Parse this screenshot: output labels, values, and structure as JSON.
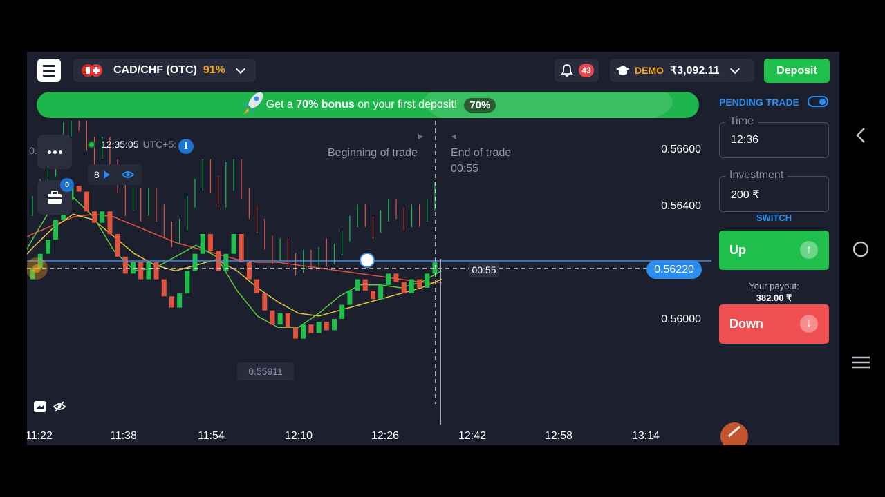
{
  "header": {
    "asset_name": "CAD/CHF (OTC)",
    "asset_payout_pct": "91%",
    "notifications_count": "43",
    "account_type": "DEMO",
    "balance": "₹3,092.11",
    "deposit_label": "Deposit"
  },
  "banner": {
    "text_prefix": "Get a",
    "text_bold": "70% bonus",
    "text_suffix": "on your first deposit!",
    "tag": "70%"
  },
  "chart": {
    "clock": "12:35:05",
    "timezone": "UTC+5:",
    "indicator_count": "8",
    "portfolio_count": "0",
    "cut_price_label": "0.",
    "beginning_label": "Beginning of trade",
    "end_label": "End of trade",
    "end_timer": "00:55",
    "line_timer": "00:55",
    "current_price": "0.56220",
    "low_label": "0.55911",
    "current_time_marker": "12:36"
  },
  "right_panel": {
    "pending_trade_label": "PENDING TRADE",
    "pending_trade_enabled": true,
    "time_label": "Time",
    "time_value": "12:36",
    "investment_label": "Investment",
    "investment_value": "200 ₹",
    "switch_label": "SWITCH",
    "up_label": "Up",
    "payout_label": "Your payout:",
    "payout_value": "382.00 ₹",
    "down_label": "Down"
  },
  "colors": {
    "background": "#1c1f2d",
    "up_green": "#1fbf4c",
    "down_red": "#f04f51",
    "accent_blue": "#2a8df0",
    "orange": "#f7a31c"
  },
  "icons": {
    "menu": "hamburger-icon",
    "notifications": "bell-icon",
    "account": "graduation-cap-icon",
    "banner": "rocket-icon",
    "more": "more-dots-icon",
    "portfolio": "briefcase-icon",
    "info": "info-icon",
    "indicator_play": "play-icon",
    "indicator_visibility": "eye-icon",
    "drawing": "pencil-icon",
    "nav_back": "back-arrow-icon",
    "nav_home": "home-circle-icon",
    "nav_menu": "menu-lines-icon"
  },
  "chart_data": {
    "type": "candlestick",
    "title": "",
    "y_ticks": [
      "0.56600",
      "0.56400",
      "0.56000"
    ],
    "x_ticks": [
      "11:22",
      "11:38",
      "11:54",
      "12:10",
      "12:26",
      "12:42",
      "12:58",
      "13:14"
    ],
    "ylim": [
      0.5576,
      0.5672
    ],
    "current_price": 0.5622,
    "strike_price": 0.56224,
    "visible_low": 0.55911,
    "grid": false,
    "candles": [
      [
        0.5614,
        0.5618,
        0.5612,
        0.5619
      ],
      [
        0.5618,
        0.5623,
        0.5617,
        0.5625
      ],
      [
        0.5623,
        0.5628,
        0.5621,
        0.563
      ],
      [
        0.5628,
        0.5635,
        0.5626,
        0.5637
      ],
      [
        0.5635,
        0.5642,
        0.5633,
        0.5645
      ],
      [
        0.5642,
        0.5647,
        0.564,
        0.565
      ],
      [
        0.5647,
        0.5645,
        0.5642,
        0.565
      ],
      [
        0.5645,
        0.5638,
        0.5635,
        0.5647
      ],
      [
        0.5638,
        0.5634,
        0.563,
        0.564
      ],
      [
        0.5634,
        0.5638,
        0.5632,
        0.564
      ],
      [
        0.5638,
        0.563,
        0.5628,
        0.564
      ],
      [
        0.563,
        0.5622,
        0.562,
        0.5632
      ],
      [
        0.5622,
        0.5616,
        0.5612,
        0.5624
      ],
      [
        0.5616,
        0.562,
        0.5614,
        0.5622
      ],
      [
        0.562,
        0.5614,
        0.561,
        0.5622
      ],
      [
        0.5614,
        0.562,
        0.5612,
        0.5622
      ],
      [
        0.562,
        0.5614,
        0.561,
        0.5622
      ],
      [
        0.5614,
        0.5608,
        0.5604,
        0.5616
      ],
      [
        0.5608,
        0.5604,
        0.5601,
        0.561
      ],
      [
        0.5604,
        0.5609,
        0.5602,
        0.5611
      ],
      [
        0.5609,
        0.5617,
        0.5607,
        0.5619
      ],
      [
        0.5617,
        0.5623,
        0.5615,
        0.5625
      ],
      [
        0.5623,
        0.563,
        0.5621,
        0.5632
      ],
      [
        0.563,
        0.5624,
        0.562,
        0.5632
      ],
      [
        0.5624,
        0.5617,
        0.5615,
        0.5626
      ],
      [
        0.5617,
        0.5623,
        0.5615,
        0.5631
      ],
      [
        0.5623,
        0.563,
        0.5621,
        0.5632
      ],
      [
        0.563,
        0.562,
        0.5618,
        0.5632
      ],
      [
        0.562,
        0.5614,
        0.5611,
        0.5622
      ],
      [
        0.5614,
        0.5609,
        0.5606,
        0.5616
      ],
      [
        0.5609,
        0.5603,
        0.56,
        0.5611
      ],
      [
        0.5603,
        0.5598,
        0.5595,
        0.5605
      ],
      [
        0.5598,
        0.5602,
        0.5596,
        0.5604
      ],
      [
        0.5602,
        0.5597,
        0.5594,
        0.5604
      ],
      [
        0.5597,
        0.5593,
        0.5591,
        0.5599
      ],
      [
        0.5593,
        0.5598,
        0.5592,
        0.56
      ],
      [
        0.5598,
        0.5595,
        0.5593,
        0.56
      ],
      [
        0.5595,
        0.5599,
        0.5594,
        0.5601
      ],
      [
        0.5599,
        0.5596,
        0.5594,
        0.5604
      ],
      [
        0.5596,
        0.56,
        0.5595,
        0.5602
      ],
      [
        0.56,
        0.5605,
        0.5598,
        0.5607
      ],
      [
        0.5605,
        0.561,
        0.5603,
        0.5612
      ],
      [
        0.561,
        0.5614,
        0.5608,
        0.5616
      ],
      [
        0.5614,
        0.561,
        0.5608,
        0.5616
      ],
      [
        0.561,
        0.5607,
        0.5604,
        0.5612
      ],
      [
        0.5607,
        0.5612,
        0.5606,
        0.5614
      ],
      [
        0.5612,
        0.5616,
        0.561,
        0.5618
      ],
      [
        0.5616,
        0.5613,
        0.5611,
        0.5618
      ],
      [
        0.5613,
        0.5609,
        0.5607,
        0.5615
      ],
      [
        0.5609,
        0.5614,
        0.5608,
        0.5616
      ],
      [
        0.5614,
        0.5611,
        0.5608,
        0.5616
      ],
      [
        0.5611,
        0.5616,
        0.561,
        0.5618
      ],
      [
        0.5616,
        0.562,
        0.5614,
        0.5624
      ]
    ],
    "series": [
      {
        "name": "",
        "color": "#e0533f",
        "values": [
          0.5626,
          0.563,
          0.5633,
          0.5636,
          0.5637,
          0.5636,
          0.5633,
          0.563,
          0.5627,
          0.5625,
          0.5623,
          0.5621,
          0.562,
          0.562,
          0.5619,
          0.5618,
          0.5617,
          0.5616,
          0.5615,
          0.5614,
          0.5613,
          0.5613
        ]
      },
      {
        "name": "",
        "color": "#e3c53a",
        "values": [
          0.5617,
          0.5625,
          0.5632,
          0.5637,
          0.5635,
          0.5629,
          0.5623,
          0.5619,
          0.5617,
          0.5619,
          0.5621,
          0.5617,
          0.5611,
          0.5606,
          0.5602,
          0.5601,
          0.5603,
          0.5605,
          0.5607,
          0.5609,
          0.5611,
          0.5614
        ]
      },
      {
        "name": "",
        "color": "#5ccb3c",
        "values": [
          0.5615,
          0.5628,
          0.564,
          0.5643,
          0.5636,
          0.5624,
          0.5617,
          0.5618,
          0.5622,
          0.5626,
          0.5622,
          0.561,
          0.5601,
          0.5597,
          0.5597,
          0.5602,
          0.5608,
          0.5612,
          0.5612,
          0.5611,
          0.5613,
          0.5617
        ]
      }
    ]
  }
}
